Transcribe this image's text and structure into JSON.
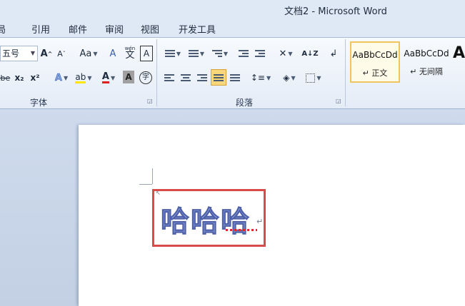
{
  "window": {
    "title": "文档2 - Microsoft Word"
  },
  "menu": {
    "tabs": [
      "布局",
      "引用",
      "邮件",
      "审阅",
      "视图",
      "开发工具"
    ],
    "first_visible": "局"
  },
  "ribbon": {
    "groups": {
      "font": "字体",
      "paragraph": "段落"
    },
    "font_size": "五号",
    "buttons": {
      "grow_font": "A",
      "shrink_font": "A",
      "change_case": "Aa",
      "clear_format_glyph": "A",
      "phonetic_guide": "wén",
      "char_border": "A",
      "subscript": "x₂",
      "superscript": "x²",
      "text_effects": "A",
      "font_color": "A",
      "char_shading": "A",
      "enclose_char": "字",
      "strikethrough": "abe",
      "sort": "A↓Z",
      "show_marks": "↲"
    },
    "styles": [
      {
        "sample": "AaBbCcDd",
        "name": "↵ 正文",
        "selected": true
      },
      {
        "sample": "AaBbCcDd",
        "name": "↵ 无间隔",
        "selected": false
      },
      {
        "sample": "A",
        "name": "",
        "selected": false
      }
    ]
  },
  "document": {
    "text": "哈哈哈",
    "paragraph_mark": "↵"
  },
  "colors": {
    "accent_selected": "#f8d77a",
    "annotation_box": "#d94b4b",
    "text_fill": "#9fb2e0"
  }
}
